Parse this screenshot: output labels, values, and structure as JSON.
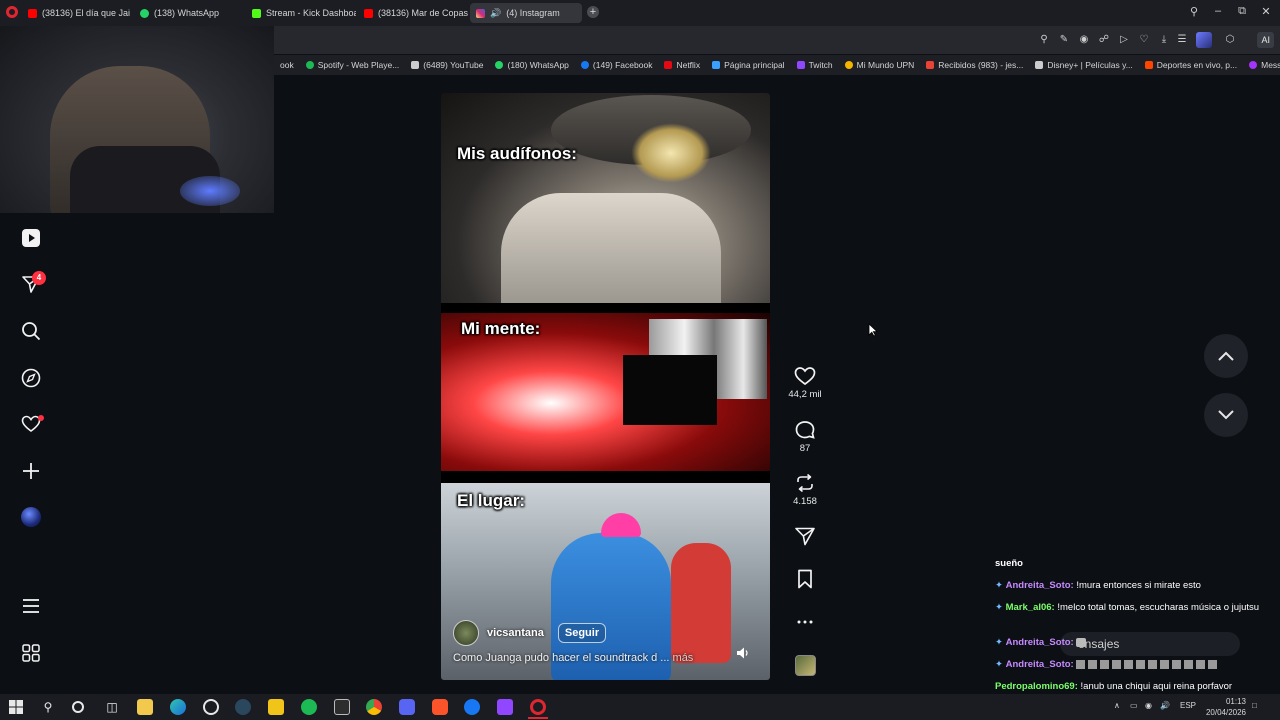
{
  "browser": {
    "tabs": [
      {
        "label": "(38136) El día que Jaime l",
        "favicon_color": "#ff0000"
      },
      {
        "label": "(138) WhatsApp",
        "favicon_color": "#25d366"
      },
      {
        "label": "Stream - Kick Dashboard",
        "favicon_color": "#53fc18"
      },
      {
        "label": "(38136) Mar de Copas - L",
        "favicon_color": "#ff0000"
      },
      {
        "label": "(4) Instagram",
        "favicon_color": "#d62976",
        "active": true
      }
    ],
    "ai_button": "AI",
    "bookmarks": [
      {
        "label": "ook",
        "color": "#1877f2"
      },
      {
        "label": "Spotify - Web Playe...",
        "color": "#1db954"
      },
      {
        "label": "(6489) YouTube",
        "color": "#cccccc"
      },
      {
        "label": "(180) WhatsApp",
        "color": "#25d366"
      },
      {
        "label": "(149) Facebook",
        "color": "#1877f2"
      },
      {
        "label": "Netflix",
        "color": "#e50914"
      },
      {
        "label": "Página principal",
        "color": "#3aa0ff"
      },
      {
        "label": "Twitch",
        "color": "#9146ff"
      },
      {
        "label": "Mi Mundo UPN",
        "color": "#f4b400"
      },
      {
        "label": "Recibidos (983) - jes...",
        "color": "#ea4335"
      },
      {
        "label": "Disney+ | Películas y...",
        "color": "#cccccc"
      },
      {
        "label": "Deportes en vivo, p...",
        "color": "#ff4500"
      },
      {
        "label": "Messenger",
        "color": "#a334fa"
      }
    ]
  },
  "instagram": {
    "nav": {
      "notifications_badge": "4"
    },
    "reel": {
      "captions": [
        "Mis audífonos:",
        "Mi mente:",
        "El lugar:"
      ],
      "author": "vicsantana",
      "follow_label": "Seguir",
      "description": "Como Juanga pudo hacer el soundtrack d ...",
      "more_label": "más"
    },
    "actions": {
      "likes": "44,2 mil",
      "comments": "87",
      "reposts": "4.158"
    }
  },
  "chat": {
    "lines": [
      {
        "user": "",
        "text": "sueño",
        "color": "#ffffff"
      },
      {
        "user": "Andreita_Soto:",
        "text": "!mura entonces si mirate esto",
        "color": "#c58bff"
      },
      {
        "user": "Mark_al06:",
        "text": "!melco total tomas, escucharas música o jujutsu",
        "color": "#7cff6b"
      },
      {
        "user": "Andreita_Soto:",
        "text": "",
        "color": "#c58bff"
      },
      {
        "user": "Andreita_Soto:",
        "text": "",
        "color": "#c58bff"
      },
      {
        "user": "Pedropalomino69:",
        "text": "!anub una chiqui aqui reina porfavor https://goo.su/uljvS",
        "color": "#7cff6b"
      }
    ],
    "messages_pill": "ensajes"
  },
  "taskbar": {
    "language": "ESP",
    "time": "01:13",
    "date": "20/04/2026"
  }
}
